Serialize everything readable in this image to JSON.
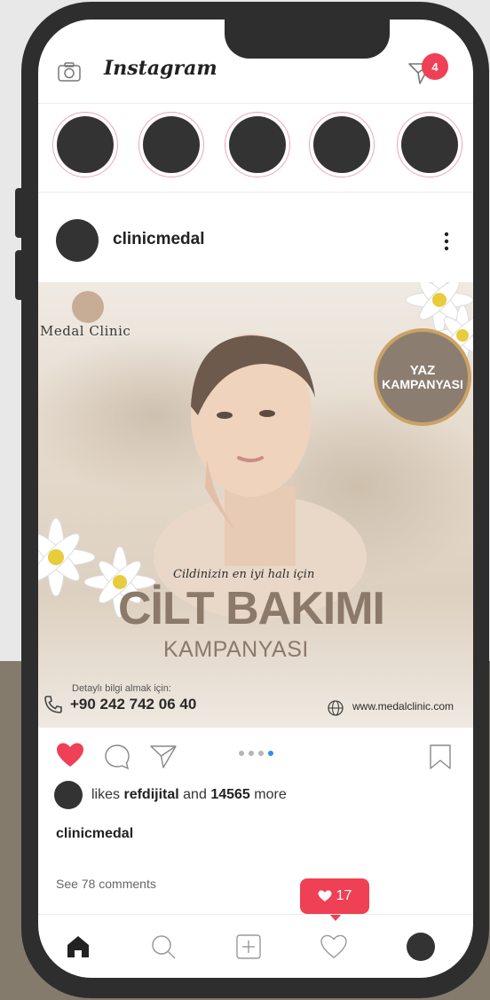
{
  "app": {
    "logo": "Instagram",
    "dm_badge_count": "4"
  },
  "stories": {
    "count": 5
  },
  "post": {
    "username": "clinicmedal",
    "image": {
      "brand_name": "Medal Clinic",
      "badge_line1": "YAZ",
      "badge_line2": "KAMPANYASI",
      "script_line": "Cildinizin en iyi halı için",
      "title": "CİLT BAKIMI",
      "subtitle": "KAMPANYASI",
      "detail_label": "Detaylı bilgi almak için:",
      "phone": "+90 242 742 06 40",
      "website": "www.medalclinic.com"
    },
    "carousel": {
      "total": 4,
      "active": 4
    },
    "likes": {
      "prefix": "likes",
      "user": "refdijital",
      "joiner": "and",
      "count": "14565",
      "suffix": "more"
    },
    "caption_user": "clinicmedal",
    "comments_link": "See 78 comments"
  },
  "notification": {
    "likes_count": "17"
  },
  "colors": {
    "accent_red": "#ef4055",
    "brand_brown": "#8b7a6a",
    "dot_active": "#2f8ef7"
  },
  "icons": {
    "top": [
      "camera-icon",
      "direct-message-icon"
    ],
    "actions": [
      "heart-icon",
      "comment-icon",
      "send-icon",
      "bookmark-icon"
    ],
    "nav": [
      "home-icon",
      "search-icon",
      "add-post-icon",
      "activity-heart-icon",
      "profile-avatar"
    ]
  }
}
